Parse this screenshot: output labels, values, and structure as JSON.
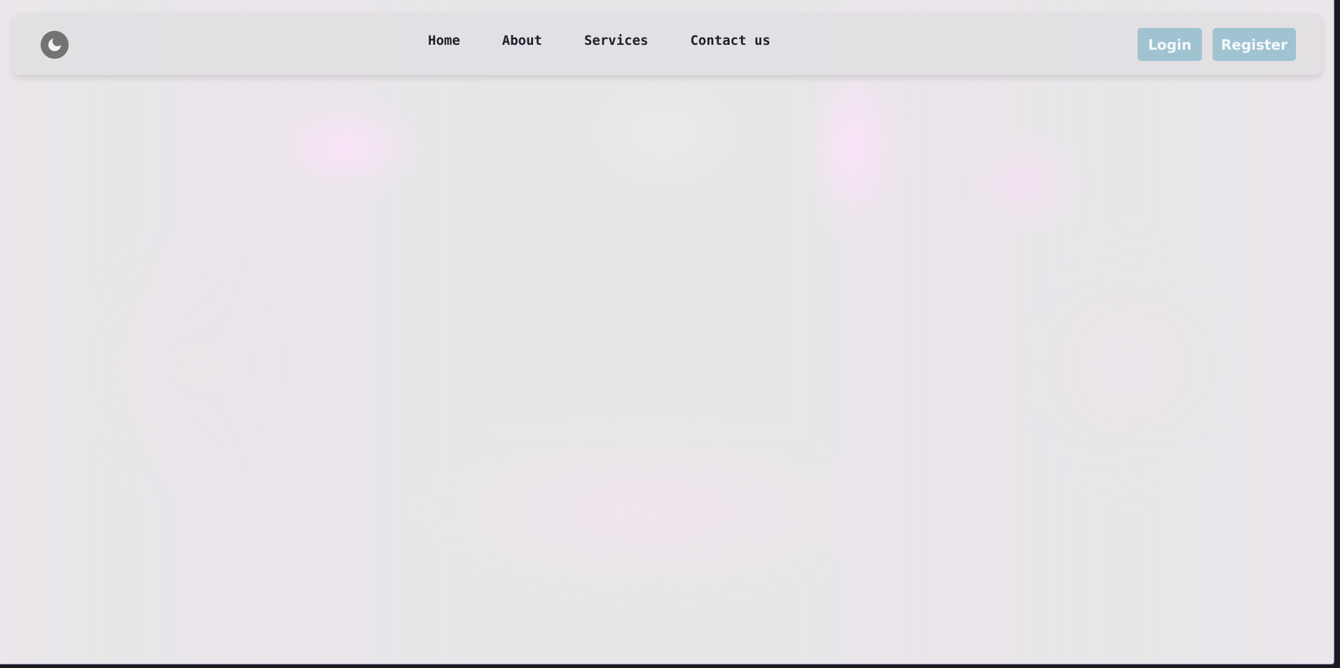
{
  "navbar": {
    "logo_icon": "moon-icon",
    "links": [
      {
        "label": "Home"
      },
      {
        "label": "About"
      },
      {
        "label": "Services"
      },
      {
        "label": "Contact us"
      }
    ],
    "auth": {
      "login_label": "Login",
      "register_label": "Register"
    }
  },
  "colors": {
    "page_background": "#e7e7e8",
    "navbar_background": "#e2e0e3",
    "button_background": "#9fc3d1",
    "nav_text": "#1d1d2b"
  }
}
